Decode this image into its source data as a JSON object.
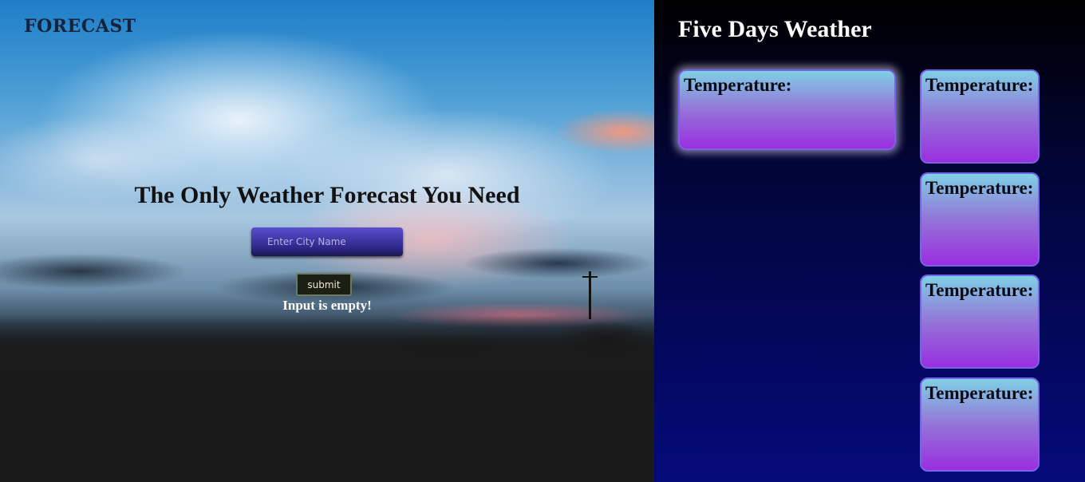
{
  "hero": {
    "brand": "FORECAST",
    "headline": "The Only Weather Forecast You Need",
    "search": {
      "placeholder": "Enter City Name",
      "value": ""
    },
    "submit_label": "submit",
    "error_message": "Input is empty!"
  },
  "forecast": {
    "title": "Five Days Weather",
    "today": {
      "label": "Temperature:"
    },
    "days": [
      {
        "label": "Temperature:"
      },
      {
        "label": "Temperature:"
      },
      {
        "label": "Temperature:"
      },
      {
        "label": "Temperature:"
      }
    ]
  },
  "colors": {
    "panel_gradient_top": "#000000",
    "panel_gradient_bottom": "#050a7a",
    "card_gradient_top": "#7fd0e6",
    "card_gradient_bottom": "#9a2ee0",
    "card_border": "#7a62e8",
    "input_gradient": "#5a4fcf"
  }
}
